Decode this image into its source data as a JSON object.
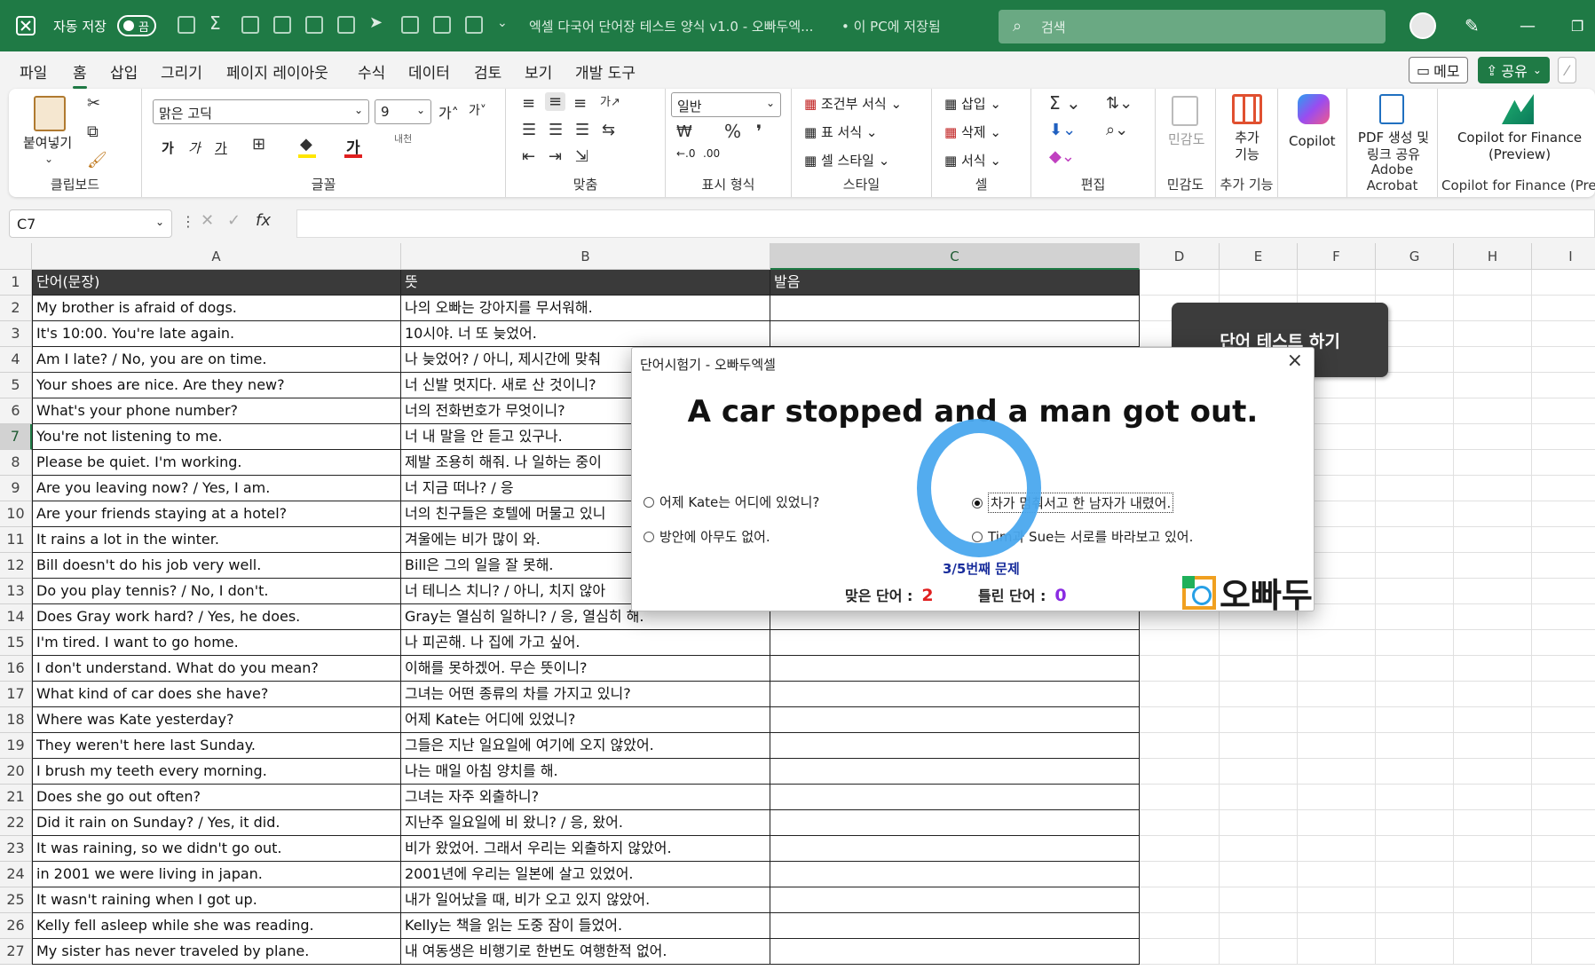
{
  "title": {
    "autosave_label": "자동 저장",
    "autosave_state": "끔",
    "doc_title": "엑셀 다국어 단어장 테스트 양식 v1.0 - 오빠두엑...",
    "save_location": "• 이 PC에 저장됨",
    "search_placeholder": "검색"
  },
  "menu": {
    "items": [
      "파일",
      "홈",
      "삽입",
      "그리기",
      "페이지 레이아웃",
      "수식",
      "데이터",
      "검토",
      "보기",
      "개발 도구"
    ],
    "active": "홈",
    "memo": "메모",
    "share": "공유"
  },
  "ribbon": {
    "clipboard": {
      "paste": "붙여넣기",
      "label": "클립보드"
    },
    "font": {
      "name": "맑은 고딕",
      "size": "9",
      "label": "글꼴"
    },
    "align": {
      "label": "맞춤"
    },
    "number": {
      "format": "일반",
      "label": "표시 형식"
    },
    "style": {
      "cond": "조건부 서식",
      "table": "표 서식",
      "cell": "셀 스타일",
      "label": "스타일"
    },
    "cells": {
      "insert": "삽입",
      "delete": "삭제",
      "format": "서식",
      "label": "셀"
    },
    "edit": {
      "label": "편집"
    },
    "sensitivity": {
      "btn": "민감도",
      "label": "민감도"
    },
    "addins": {
      "btn": "추가 기능",
      "label": "추가 기능"
    },
    "copilot": {
      "btn": "Copilot"
    },
    "acrobat": {
      "btn": "PDF 생성 및 링크 공유",
      "label": "Adobe Acrobat"
    },
    "finance": {
      "btn": "Copilot for Finance (Preview)",
      "label": "Copilot for Finance (Prev"
    }
  },
  "formula": {
    "namebox": "C7",
    "fx": "fx",
    "content": ""
  },
  "grid": {
    "columns": [
      "A",
      "B",
      "C",
      "D",
      "E",
      "F",
      "G",
      "H",
      "I"
    ],
    "selected_col": "C",
    "selected_row": "7",
    "header": [
      "단어(문장)",
      "뜻",
      "발음"
    ],
    "rows": [
      [
        "My brother is afraid of dogs.",
        "나의 오빠는 강아지를 무서워해."
      ],
      [
        "It's 10:00. You're late again.",
        "10시야. 너 또 늦었어."
      ],
      [
        "Am I late? / No, you are on time.",
        "나 늦었어? / 아니, 제시간에 맞춰"
      ],
      [
        "Your shoes are nice. Are they new?",
        "너 신발 멋지다. 새로 산 것이니?"
      ],
      [
        "What's your phone number?",
        "너의 전화번호가 무엇이니?"
      ],
      [
        "You're not listening to me.",
        "너 내 말을 안 듣고 있구나."
      ],
      [
        "Please be quiet. I'm working.",
        "제발 조용히 해줘. 나 일하는 중이"
      ],
      [
        "Are you leaving now? / Yes, I am.",
        "너 지금 떠나? / 응"
      ],
      [
        "Are your friends staying at a hotel?",
        "너의 친구들은 호텔에 머물고 있니"
      ],
      [
        "It rains a lot in the winter.",
        "겨울에는 비가 많이 와."
      ],
      [
        "Bill doesn't do his job very well.",
        "Bill은 그의 일을 잘 못해."
      ],
      [
        "Do you play tennis? / No, I don't.",
        "너 테니스 치니? / 아니, 치지 않아"
      ],
      [
        "Does Gray work hard? / Yes, he does.",
        "Gray는 열심히 일하니? / 응, 열심히 해."
      ],
      [
        "I'm tired. I want to go home.",
        "나 피곤해. 나 집에 가고 싶어."
      ],
      [
        "I don't understand. What do you mean?",
        "이해를 못하겠어. 무슨 뜻이니?"
      ],
      [
        "What kind of car does she have?",
        "그녀는 어떤 종류의 차를 가지고 있니?"
      ],
      [
        "Where was Kate yesterday?",
        "어제 Kate는 어디에 있었니?"
      ],
      [
        "They weren't here last Sunday.",
        "그들은 지난 일요일에 여기에 오지 않았어."
      ],
      [
        "I brush my teeth every morning.",
        "나는 매일 아침 양치를 해."
      ],
      [
        "Does she go out often?",
        "그녀는 자주 외출하니?"
      ],
      [
        "Did it rain on Sunday? / Yes, it did.",
        "지난주 일요일에 비 왔니? / 응, 왔어."
      ],
      [
        "It was raining, so we didn't go out.",
        "비가 왔었어. 그래서 우리는 외출하지 않았어."
      ],
      [
        "in 2001 we were living in japan.",
        "2001년에 우리는 일본에 살고 있었어."
      ],
      [
        "It wasn't raining when I got up.",
        "내가 일어났을 때, 비가 오고 있지 않았어."
      ],
      [
        "Kelly fell asleep while she was reading.",
        "Kelly는 책을 읽는 도중 잠이 들었어."
      ],
      [
        "My sister has never traveled by plane.",
        "내 여동생은 비행기로 한번도 여행한적 없어."
      ]
    ],
    "row_numbers": [
      "1",
      "2",
      "3",
      "4",
      "5",
      "6",
      "7",
      "8",
      "9",
      "10",
      "11",
      "12",
      "13",
      "14",
      "15",
      "16",
      "17",
      "18",
      "19",
      "20",
      "21",
      "22",
      "23",
      "24",
      "25",
      "26",
      "27"
    ]
  },
  "test_button": "단어 테스트 하기",
  "dialog": {
    "title": "단어시험기 - 오빠두엑셀",
    "question": "A car stopped and a man got out.",
    "options": [
      "어제 Kate는 어디에 있었니?",
      "차가 멈춰서고 한 남자가 내렸어.",
      "방안에 아무도 없어.",
      "Tim과 Sue는 서로를 바라보고 있어."
    ],
    "selected_index": 1,
    "progress": "3/5번째 문제",
    "correct_label": "맞은 단어 :",
    "correct_value": "2",
    "wrong_label": "틀린 단어 :",
    "wrong_value": "0",
    "logo_text": "오빠두"
  },
  "colors": {
    "excel_green": "#1f7a45",
    "ring": "#4aa8ee",
    "correct": "#e02020",
    "wrong": "#8a2be2"
  }
}
